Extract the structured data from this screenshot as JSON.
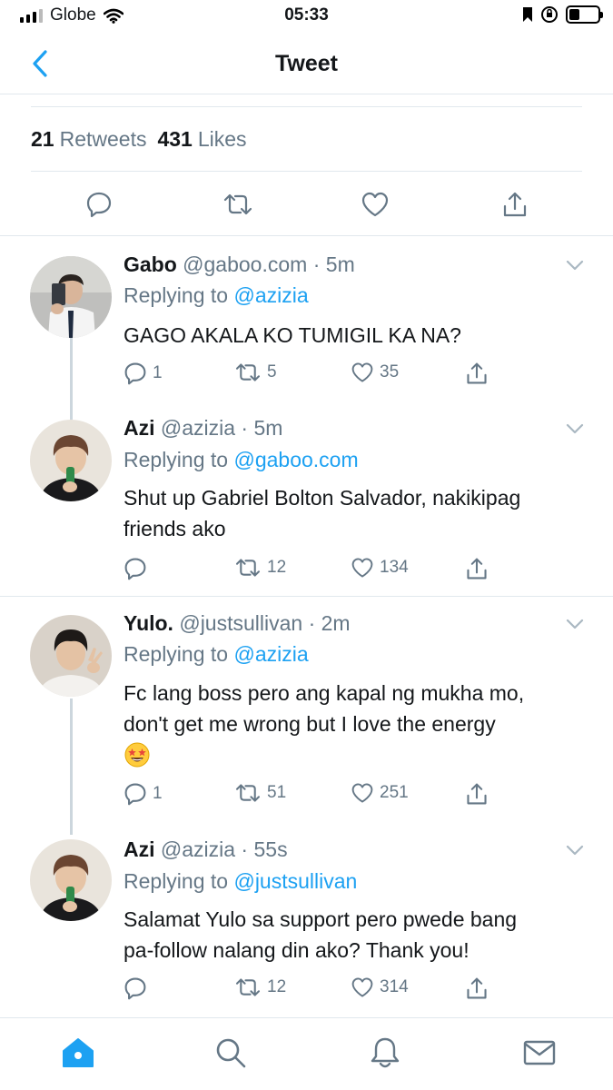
{
  "status_bar": {
    "carrier": "Globe",
    "time": "05:33"
  },
  "header": {
    "title": "Tweet"
  },
  "stats": {
    "retweets_count": "21",
    "retweets_label": "Retweets",
    "likes_count": "431",
    "likes_label": "Likes"
  },
  "tweets": [
    {
      "name": "Gabo",
      "handle": "@gaboo.com",
      "time": "5m",
      "replying_label": "Replying to",
      "replying_to": "@azizia",
      "text": "GAGO AKALA KO TUMIGIL KA NA?",
      "replies": "1",
      "retweets": "5",
      "likes": "35"
    },
    {
      "name": "Azi",
      "handle": "@azizia",
      "time": "5m",
      "replying_label": "Replying to",
      "replying_to": "@gaboo.com",
      "text_line1": "Shut up Gabriel Bolton Salvador, nakikipag",
      "text_line2": "friends ako",
      "replies": "",
      "retweets": "12",
      "likes": "134"
    },
    {
      "name": "Yulo.",
      "handle": "@justsullivan",
      "time": "2m",
      "replying_label": "Replying to",
      "replying_to": "@azizia",
      "text_line1": "Fc lang boss pero ang kapal ng mukha mo,",
      "text_line2": "don't get me wrong but I love the energy",
      "emoji": "star-struck-emoji",
      "replies": "1",
      "retweets": "51",
      "likes": "251"
    },
    {
      "name": "Azi",
      "handle": "@azizia",
      "time": "55s",
      "replying_label": "Replying to",
      "replying_to": "@justsullivan",
      "text_line1": "Salamat Yulo sa support pero pwede bang",
      "text_line2": "pa-follow nalang din ako? Thank you!",
      "replies": "",
      "retweets": "12",
      "likes": "314"
    }
  ],
  "colors": {
    "accent": "#1da1f2",
    "secondary_text": "#657786",
    "divider": "#e1e8ed"
  },
  "icons": {
    "back": "chevron-left-icon",
    "reply": "speech-bubble-icon",
    "retweet": "retweet-icon",
    "like": "heart-icon",
    "share": "share-icon",
    "more": "chevron-down-icon",
    "tab_home": "home-icon",
    "tab_search": "search-icon",
    "tab_notifications": "bell-icon",
    "tab_messages": "envelope-icon"
  }
}
